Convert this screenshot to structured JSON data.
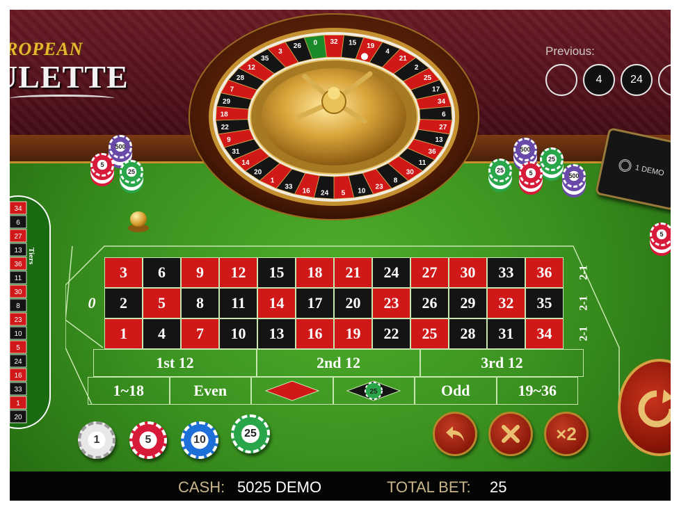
{
  "game": {
    "logo_line1": "ROPEAN",
    "logo_line2": "ULETTE"
  },
  "previous": {
    "label": "Previous:",
    "results": [
      "",
      "4",
      "24",
      ""
    ]
  },
  "wheel": {
    "numbers": [
      "32",
      "15",
      "19",
      "4",
      "21",
      "2",
      "25",
      "17",
      "34",
      "6",
      "27",
      "13",
      "36",
      "11",
      "30",
      "8",
      "23",
      "10",
      "5",
      "24",
      "16",
      "33",
      "1",
      "20",
      "14",
      "31",
      "9",
      "22",
      "18",
      "29",
      "7",
      "28",
      "12",
      "35",
      "3",
      "26"
    ],
    "zero": "0",
    "ball_number": "19"
  },
  "table": {
    "zero_label": "0",
    "rows": [
      [
        {
          "n": "3",
          "c": "red"
        },
        {
          "n": "6",
          "c": "black"
        },
        {
          "n": "9",
          "c": "red"
        },
        {
          "n": "12",
          "c": "red"
        },
        {
          "n": "15",
          "c": "black"
        },
        {
          "n": "18",
          "c": "red"
        },
        {
          "n": "21",
          "c": "red"
        },
        {
          "n": "24",
          "c": "black"
        },
        {
          "n": "27",
          "c": "red"
        },
        {
          "n": "30",
          "c": "red"
        },
        {
          "n": "33",
          "c": "black"
        },
        {
          "n": "36",
          "c": "red"
        }
      ],
      [
        {
          "n": "2",
          "c": "black"
        },
        {
          "n": "5",
          "c": "red"
        },
        {
          "n": "8",
          "c": "black"
        },
        {
          "n": "11",
          "c": "black"
        },
        {
          "n": "14",
          "c": "red"
        },
        {
          "n": "17",
          "c": "black"
        },
        {
          "n": "20",
          "c": "black"
        },
        {
          "n": "23",
          "c": "red"
        },
        {
          "n": "26",
          "c": "black"
        },
        {
          "n": "29",
          "c": "black"
        },
        {
          "n": "32",
          "c": "red"
        },
        {
          "n": "35",
          "c": "black"
        }
      ],
      [
        {
          "n": "1",
          "c": "red"
        },
        {
          "n": "4",
          "c": "black"
        },
        {
          "n": "7",
          "c": "red"
        },
        {
          "n": "10",
          "c": "black"
        },
        {
          "n": "13",
          "c": "black"
        },
        {
          "n": "16",
          "c": "red"
        },
        {
          "n": "19",
          "c": "red"
        },
        {
          "n": "22",
          "c": "black"
        },
        {
          "n": "25",
          "c": "red"
        },
        {
          "n": "28",
          "c": "black"
        },
        {
          "n": "31",
          "c": "black"
        },
        {
          "n": "34",
          "c": "red"
        }
      ]
    ],
    "column_labels": [
      "2-1",
      "2-1",
      "2-1"
    ],
    "dozens": [
      "1st 12",
      "2nd 12",
      "3rd 12"
    ],
    "even_money": [
      "1~18",
      "Even",
      "",
      "",
      "Odd",
      "19~36"
    ],
    "placed_bet_value": "25"
  },
  "racetrack": {
    "numbers": [
      "34",
      "6",
      "27",
      "13",
      "36",
      "11",
      "30",
      "8",
      "23",
      "10",
      "5",
      "24",
      "16",
      "33",
      "1",
      "20"
    ],
    "label_tiers": "Tiers"
  },
  "chips": [
    {
      "value": "1",
      "color": "#e8e8e8",
      "accent": "#9a9a9a",
      "text": "#333333"
    },
    {
      "value": "5",
      "color": "#d81a3a",
      "accent": "#ffffff",
      "text": "#333333"
    },
    {
      "value": "10",
      "color": "#1e6fd8",
      "accent": "#ffffff",
      "text": "#333333"
    },
    {
      "value": "25",
      "color": "#2aa64a",
      "accent": "#ffffff",
      "text": "#222222"
    }
  ],
  "decor_chips": {
    "left": [
      "500",
      "5",
      "25"
    ],
    "right": [
      "500",
      "25",
      "25",
      "5",
      "500",
      "5"
    ]
  },
  "demo_card": {
    "label": "1 DEMO"
  },
  "controls": {
    "undo_icon": "undo-arrow-icon",
    "clear_icon": "x-icon",
    "double_label": "×2",
    "spin_icon": "spin-refresh-icon"
  },
  "status": {
    "cash_label": "CASH:",
    "cash_value": "5025 DEMO",
    "bet_label": "TOTAL BET:",
    "bet_value": "25"
  },
  "colors": {
    "red": "#d01818",
    "black": "#141414",
    "felt": "#3b9320",
    "gold": "#d4a042"
  }
}
